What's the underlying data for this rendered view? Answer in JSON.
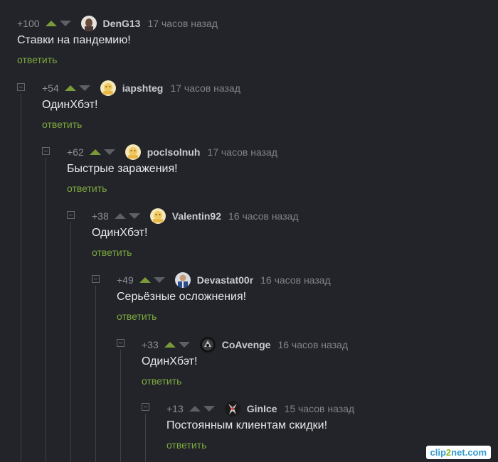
{
  "comments": [
    {
      "rating": "+100",
      "upvote_active": true,
      "username": "DenG13",
      "time": "17 часов назад",
      "text": "Ставки на пандемию!",
      "reply": "ответить",
      "avatar": "avatar-photo-icon"
    },
    {
      "rating": "+54",
      "upvote_active": true,
      "username": "iapshteg",
      "time": "17 часов назад",
      "text": "ОдинХбэт!",
      "reply": "ответить",
      "avatar": "avatar-default-icon"
    },
    {
      "rating": "+62",
      "upvote_active": true,
      "username": "poclsolnuh",
      "time": "17 часов назад",
      "text": "Быстрые заражения!",
      "reply": "ответить",
      "avatar": "avatar-default-icon"
    },
    {
      "rating": "+38",
      "upvote_active": false,
      "username": "Valentin92",
      "time": "16 часов назад",
      "text": "ОдинХбэт!",
      "reply": "ответить",
      "avatar": "avatar-default-icon"
    },
    {
      "rating": "+49",
      "upvote_active": true,
      "username": "Devastat00r",
      "time": "16 часов назад",
      "text": "Серьёзные осложнения!",
      "reply": "ответить",
      "avatar": "avatar-photo-icon"
    },
    {
      "rating": "+33",
      "upvote_active": true,
      "username": "CoAvenge",
      "time": "16 часов назад",
      "text": "ОдинХбэт!",
      "reply": "ответить",
      "avatar": "avatar-photo-icon"
    },
    {
      "rating": "+13",
      "upvote_active": false,
      "username": "GinIce",
      "time": "15 часов назад",
      "text": "Постоянным клиентам скидки!",
      "reply": "ответить",
      "avatar": "avatar-photo-icon"
    }
  ],
  "watermark": {
    "part1": "clip",
    "part2": "2",
    "part3": "net",
    "part4": ".com"
  },
  "colors": {
    "background": "#222429",
    "accent_green": "#7eaa3e",
    "text": "#e7e8ea",
    "muted": "#80848b"
  }
}
